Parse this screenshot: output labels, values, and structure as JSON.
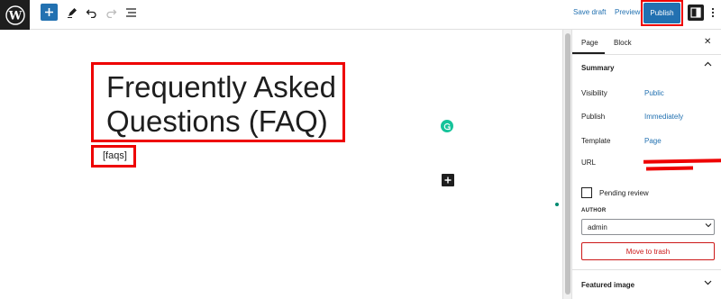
{
  "toolbar": {
    "save_draft": "Save draft",
    "preview": "Preview",
    "publish": "Publish"
  },
  "editor": {
    "title_line1": "Frequently Asked",
    "title_line2": "Questions (FAQ)",
    "shortcode": "[faqs]"
  },
  "sidebar": {
    "tabs": [
      {
        "label": "Page",
        "active": true
      },
      {
        "label": "Block",
        "active": false
      }
    ],
    "summary": {
      "heading": "Summary",
      "rows": [
        {
          "label": "Visibility",
          "value": "Public"
        },
        {
          "label": "Publish",
          "value": "Immediately"
        },
        {
          "label": "Template",
          "value": "Page"
        },
        {
          "label": "URL",
          "value": ""
        }
      ],
      "pending_review": "Pending review",
      "pending_checked": false,
      "author_label": "AUTHOR",
      "author_value": "admin",
      "trash": "Move to trash"
    },
    "featured_image": "Featured image"
  },
  "colors": {
    "accent": "#2271b1",
    "dark": "#1e1e1e",
    "annotation_red": "#e00000",
    "danger": "#cc1818",
    "grammarly": "#15c39a"
  }
}
